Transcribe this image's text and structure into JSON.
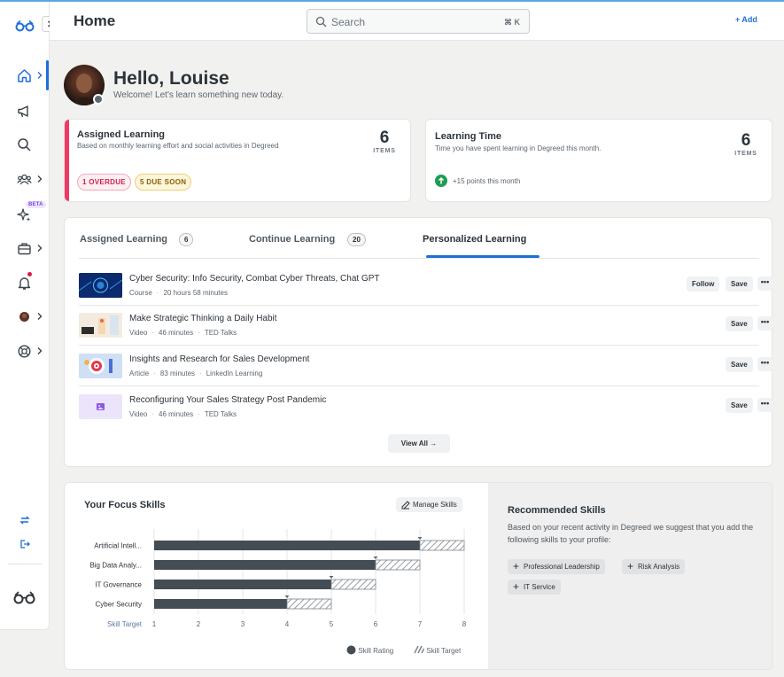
{
  "header": {
    "title": "Home",
    "search_placeholder": "Search",
    "search_shortcut": "⌘ K",
    "add_label": "+ Add"
  },
  "sidebar": {
    "beta_label": "BETA",
    "items": [
      "home",
      "announcements",
      "search",
      "groups",
      "ai-assistant",
      "career",
      "notifications",
      "profile",
      "help"
    ]
  },
  "greeting": {
    "hello": "Hello, Louise",
    "welcome": "Welcome! Let's learn something new today."
  },
  "assigned_card": {
    "title": "Assigned Learning",
    "subtitle": "Based on monthly learning effort and social activities in Degreed",
    "count": "6",
    "unit": "ITEMS",
    "overdue": "1 OVERDUE",
    "due_soon": "5 DUE SOON",
    "accent": "#ef3a64"
  },
  "time_card": {
    "title": "Learning Time",
    "subtitle": "Time you have spent learning in Degreed this month.",
    "count": "6",
    "unit": "ITEMS",
    "points": "+15 points this month"
  },
  "tabs": [
    {
      "label": "Assigned Learning",
      "count": "6"
    },
    {
      "label": "Continue Learning",
      "count": "20"
    },
    {
      "label": "Personalized Learning",
      "count": ""
    }
  ],
  "learning_items": [
    {
      "title": "Cyber Security: Info Security, Combat Cyber Threats, Chat GPT",
      "type": "Course",
      "duration": "20 hours 58 minutes",
      "provider": "",
      "follow": "Follow",
      "save": "Save"
    },
    {
      "title": "Make Strategic Thinking a Daily Habit",
      "type": "Video",
      "duration": "46 minutes",
      "provider": "TED Talks",
      "follow": "",
      "save": "Save"
    },
    {
      "title": "Insights and Research for Sales Development",
      "type": "Article",
      "duration": "83 minutes",
      "provider": "LinkedIn Learning",
      "follow": "",
      "save": "Save"
    },
    {
      "title": "Reconfiguring Your Sales Strategy Post Pandemic",
      "type": "Video",
      "duration": "46 minutes",
      "provider": "TED Talks",
      "follow": "",
      "save": "Save"
    }
  ],
  "more_label": "•••",
  "view_all": "View All",
  "focus_skills": {
    "title": "Your Focus Skills",
    "manage": "Manage Skills",
    "legend_rating": "Skill Rating",
    "legend_target": "Skill Target"
  },
  "chart_data": {
    "type": "bar",
    "orientation": "horizontal",
    "categories": [
      "Artificial Intell...",
      "Big Data Analy...",
      "IT Governance",
      "Cyber Security"
    ],
    "series": [
      {
        "name": "Skill Rating",
        "values": [
          7,
          6,
          5,
          4
        ],
        "color": "#444c54"
      },
      {
        "name": "Skill Target",
        "values": [
          8,
          7,
          6,
          5
        ],
        "color": "hatched"
      }
    ],
    "xlabel": "Skill Target",
    "xticks": [
      1,
      2,
      3,
      4,
      5,
      6,
      7,
      8
    ],
    "xlim": [
      1,
      8
    ],
    "grid": true,
    "legend": "bottom-right"
  },
  "recommended": {
    "title": "Recommended Skills",
    "desc": "Based on your recent activity in Degreed we suggest that you add the following skills to your profile:",
    "chips": [
      "Professional Leadership",
      "Risk Analysis",
      "IT Service"
    ]
  },
  "colors": {
    "accent_blue": "#1e6fd9",
    "overdue_red": "#d11d4a",
    "points_green": "#1f9d55"
  }
}
